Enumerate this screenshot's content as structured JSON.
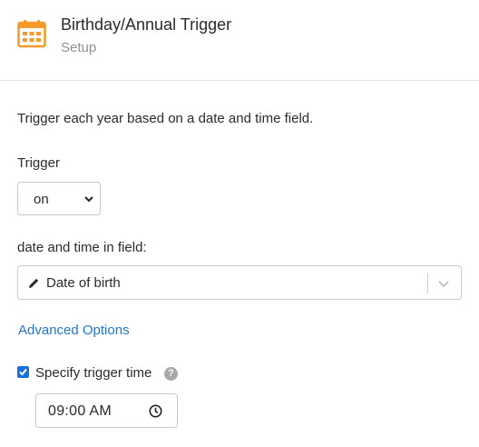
{
  "header": {
    "title": "Birthday/Annual Trigger",
    "subtitle": "Setup",
    "icon": "calendar-icon",
    "icon_color": "#f39a2a"
  },
  "description": "Trigger each year based on a date and time field.",
  "trigger": {
    "label": "Trigger",
    "selected": "on"
  },
  "field": {
    "label": "date and time in field:",
    "selected": "Date of birth",
    "icon": "pencil-icon"
  },
  "advanced_options_label": "Advanced Options",
  "specify_time": {
    "label": "Specify trigger time",
    "checked": true,
    "help_icon": "question-icon",
    "help_glyph": "?",
    "value": "09:00 AM"
  },
  "colors": {
    "link": "#2576d0",
    "checkbox": "#1a6fe0",
    "border": "#c8c8c8"
  }
}
